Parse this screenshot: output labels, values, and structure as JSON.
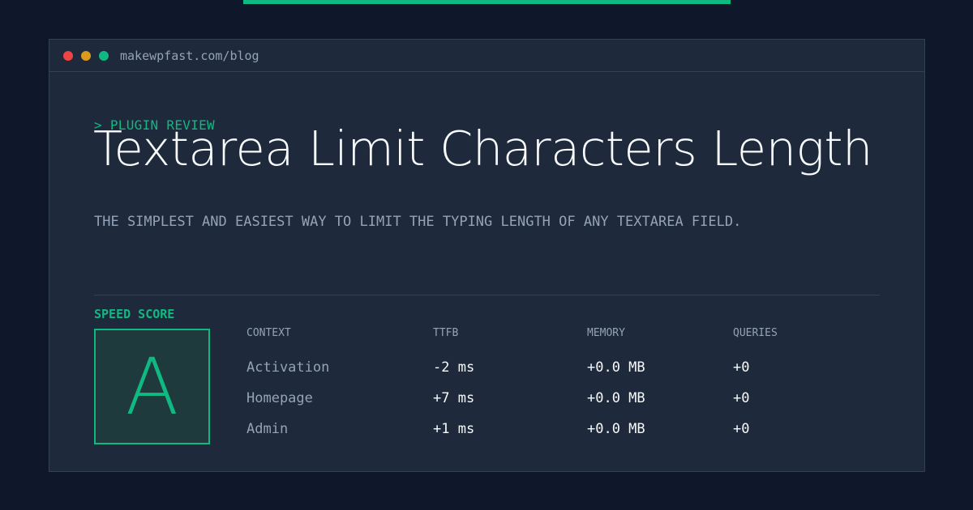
{
  "browser": {
    "url": "makewpfast.com/blog",
    "dots": [
      {
        "name": "close-dot",
        "color": "#ef4444"
      },
      {
        "name": "minimize-dot",
        "color": "#f59e0b"
      },
      {
        "name": "maximize-dot",
        "color": "#10b981"
      }
    ]
  },
  "header": {
    "eyebrow": "> PLUGIN REVIEW",
    "title": "Textarea Limit Characters Length",
    "subtitle": "THE SIMPLEST AND EASIEST WAY TO LIMIT THE TYPING LENGTH OF ANY TEXTAREA FIELD."
  },
  "score": {
    "label": "SPEED SCORE",
    "grade": "A"
  },
  "metrics": {
    "headers": [
      "CONTEXT",
      "TTFB",
      "MEMORY",
      "QUERIES"
    ],
    "rows": [
      {
        "context": "Activation",
        "ttfb": "-2 ms",
        "memory": "+0.0 MB",
        "queries": "+0"
      },
      {
        "context": "Homepage",
        "ttfb": "+7 ms",
        "memory": "+0.0 MB",
        "queries": "+0"
      },
      {
        "context": "Admin",
        "ttfb": "+1 ms",
        "memory": "+0.0 MB",
        "queries": "+0"
      }
    ]
  },
  "colors": {
    "background": "#0f172a",
    "panel": "#1e293b",
    "accent": "#10b981",
    "muted": "#94a3b8",
    "text": "#f8fafc"
  }
}
